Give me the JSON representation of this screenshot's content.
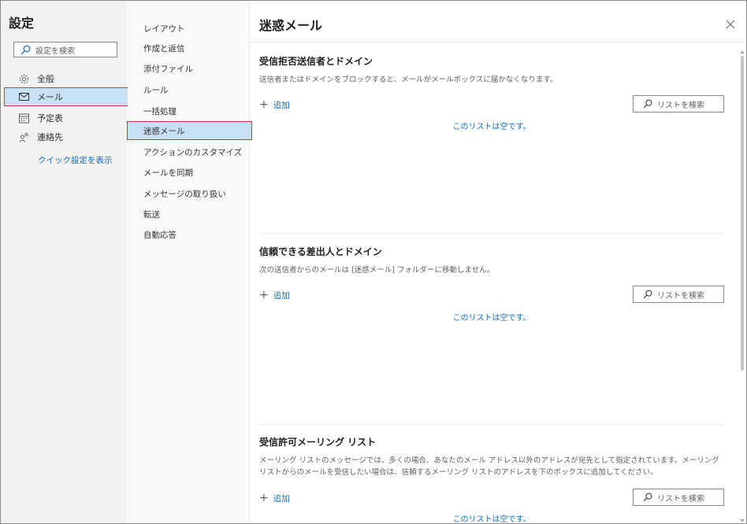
{
  "settings": {
    "title": "設定",
    "search_placeholder": "設定を検索",
    "nav": [
      {
        "label": "全般",
        "icon": "gear-icon"
      },
      {
        "label": "メール",
        "icon": "mail-icon"
      },
      {
        "label": "予定表",
        "icon": "calendar-icon"
      },
      {
        "label": "連絡先",
        "icon": "people-icon"
      }
    ],
    "quick_settings_link": "クイック設定を表示"
  },
  "mail_nav": {
    "items": [
      {
        "label": "レイアウト"
      },
      {
        "label": "作成と返信"
      },
      {
        "label": "添付ファイル"
      },
      {
        "label": "ルール"
      },
      {
        "label": "一括処理"
      },
      {
        "label": "迷惑メール"
      },
      {
        "label": "アクションのカスタマイズ"
      },
      {
        "label": "メールを同期"
      },
      {
        "label": "メッセージの取り扱い"
      },
      {
        "label": "転送"
      },
      {
        "label": "自動応答"
      }
    ],
    "selected": "迷惑メール"
  },
  "main": {
    "title": "迷惑メール",
    "sections": [
      {
        "title": "受信拒否送信者とドメイン",
        "description": "送信者またはドメインをブロックすると、メールがメールボックスに届かなくなります。",
        "add_label": "追加",
        "search_placeholder": "リストを検索",
        "empty_text": "このリストは空です。"
      },
      {
        "title": "信頼できる差出人とドメイン",
        "description": "次の送信者からのメールは [迷惑メール] フォルダーに移動しません。",
        "add_label": "追加",
        "search_placeholder": "リストを検索",
        "empty_text": "このリストは空です。"
      },
      {
        "title": "受信許可メーリング リスト",
        "description": "メーリング リストのメッセージでは、多くの場合、あなたのメール アドレス以外のアドレスが宛先として指定されています。メーリング リストからのメールを受信したい場合は、信頼するメーリング リストのアドレスを下のボックスに追加してください。",
        "add_label": "追加",
        "search_placeholder": "リストを検索",
        "empty_text": "このリストは空です。"
      }
    ]
  },
  "colors": {
    "accent": "#0c6bbf",
    "selected_bg": "#c7e0f4",
    "highlight_border": "#e0303a"
  }
}
